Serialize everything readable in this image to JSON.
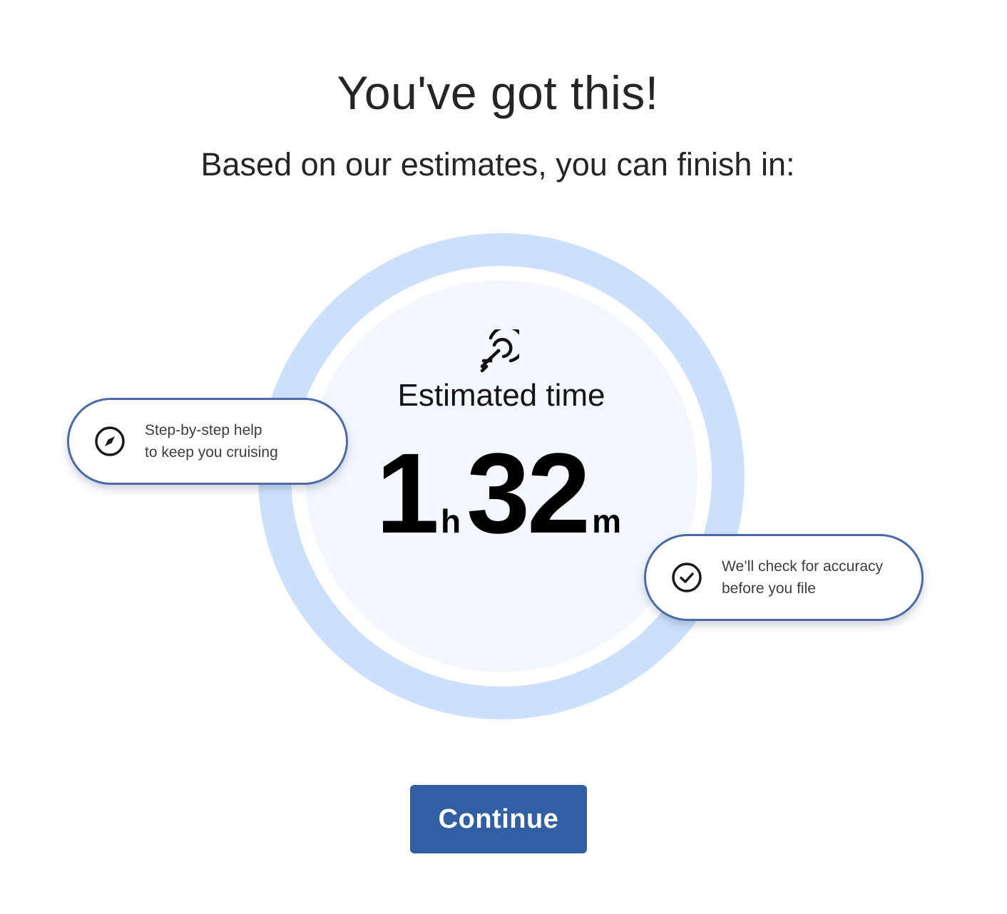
{
  "header": {
    "title": "You've got this!",
    "subtitle": "Based on our estimates, you can finish in:"
  },
  "estimate": {
    "icon": "target-rocket-icon",
    "label": "Estimated time",
    "hours": "1",
    "hours_unit": "h",
    "minutes": "32",
    "minutes_unit": "m"
  },
  "features": [
    {
      "icon": "compass-icon",
      "line1": "Step-by-step help",
      "line2": "to keep you cruising"
    },
    {
      "icon": "check-circle-icon",
      "line1": "We’ll check for accuracy",
      "line2": "before you file"
    }
  ],
  "actions": {
    "continue_label": "Continue"
  },
  "colors": {
    "ring": "#cde0fb",
    "ring_inner": "#f3f7fd",
    "pill_border": "#4b6aa6",
    "button": "#325ea3"
  }
}
